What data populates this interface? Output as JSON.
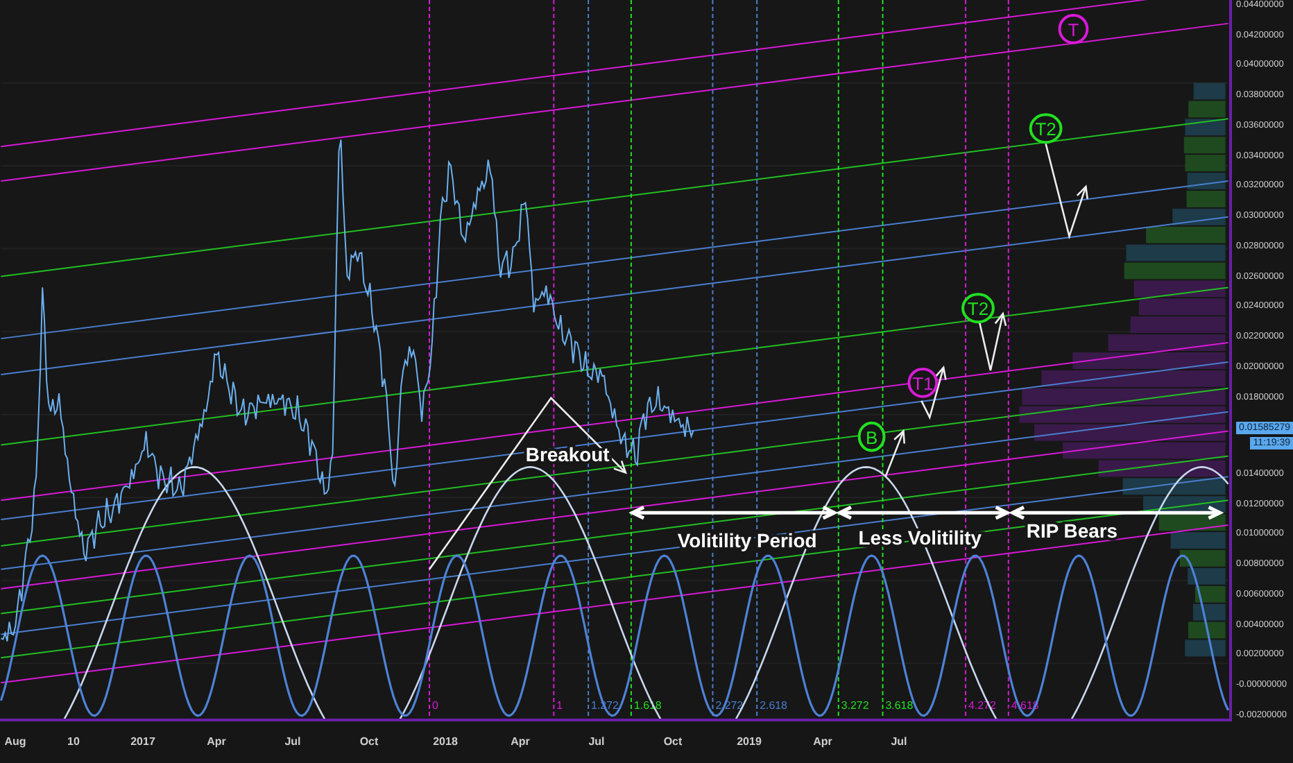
{
  "y_axis": {
    "labels": [
      "0.04400000",
      "0.04200000",
      "0.04000000",
      "0.03800000",
      "0.03600000",
      "0.03400000",
      "0.03200000",
      "0.03000000",
      "0.02800000",
      "0.02600000",
      "0.02400000",
      "0.02200000",
      "0.02000000",
      "0.01800000",
      "0.01400000",
      "0.01200000",
      "0.01000000",
      "0.00800000",
      "0.00600000",
      "0.00400000",
      "0.00200000",
      "-0.00000000",
      "-0.00200000"
    ]
  },
  "price_tag": {
    "value": "0.01585279",
    "time": "11:19:39"
  },
  "x_axis": {
    "labels": [
      "Aug",
      "10",
      "2017",
      "Apr",
      "Jul",
      "Oct",
      "2018",
      "Apr",
      "Jul",
      "Oct",
      "2019",
      "Apr",
      "Jul"
    ]
  },
  "fib_levels": [
    {
      "label": "0",
      "color": "#d81ad8"
    },
    {
      "label": "1",
      "color": "#d81ad8"
    },
    {
      "label": "1.272",
      "color": "#4a7fd0"
    },
    {
      "label": "1.618",
      "color": "#22e022"
    },
    {
      "label": "2.272",
      "color": "#4a7fd0"
    },
    {
      "label": "2.618",
      "color": "#4a7fd0"
    },
    {
      "label": "3.272",
      "color": "#22e022"
    },
    {
      "label": "3.618",
      "color": "#22e022"
    },
    {
      "label": "4.272",
      "color": "#d81ad8"
    },
    {
      "label": "4.618",
      "color": "#d81ad8"
    }
  ],
  "markers": [
    {
      "label": "B",
      "color": "#22e022"
    },
    {
      "label": "T1",
      "color": "#d81ad8"
    },
    {
      "label": "T2",
      "color": "#22e022"
    },
    {
      "label": "T2",
      "color": "#22e022"
    },
    {
      "label": "T",
      "color": "#d81ad8"
    }
  ],
  "annotations": [
    "Breakout",
    "Volitility Period",
    "Less Volitility",
    "RIP Bears"
  ]
}
